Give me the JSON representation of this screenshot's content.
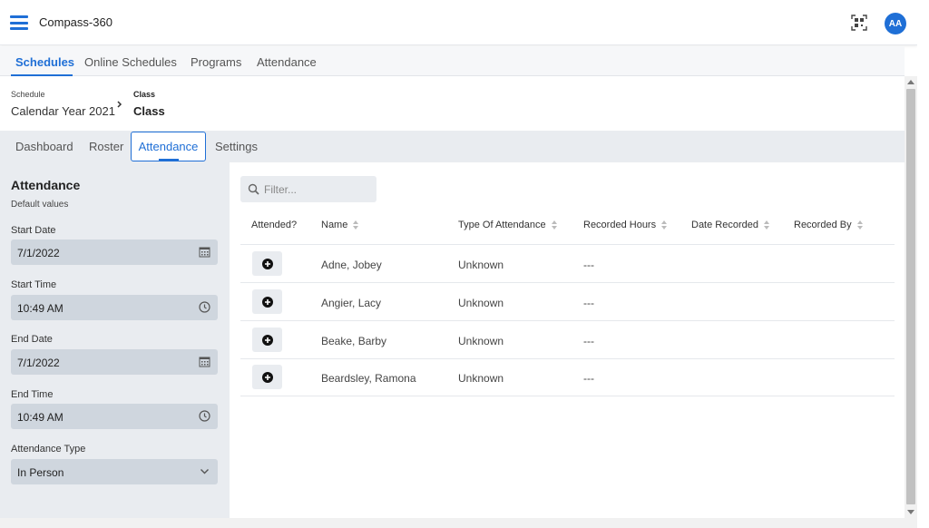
{
  "app": {
    "title": "Compass-360",
    "avatar_initials": "AA"
  },
  "main_nav": {
    "tabs": [
      {
        "label": "Schedules",
        "active": true
      },
      {
        "label": "Online Schedules"
      },
      {
        "label": "Programs"
      },
      {
        "label": "Attendance"
      }
    ]
  },
  "breadcrumb": {
    "schedule_label": "Schedule",
    "schedule_value": "Calendar Year 2021",
    "class_label": "Class",
    "class_value": "Class"
  },
  "sub_tabs": [
    {
      "label": "Dashboard"
    },
    {
      "label": "Roster"
    },
    {
      "label": "Attendance",
      "active": true
    },
    {
      "label": "Settings"
    }
  ],
  "defaults_panel": {
    "title": "Attendance",
    "subtitle": "Default values",
    "start_date": {
      "label": "Start Date",
      "value": "7/1/2022"
    },
    "start_time": {
      "label": "Start Time",
      "value": "10:49 AM"
    },
    "end_date": {
      "label": "End Date",
      "value": "7/1/2022"
    },
    "end_time": {
      "label": "End Time",
      "value": "10:49 AM"
    },
    "attendance_type": {
      "label": "Attendance Type",
      "value": "In Person"
    }
  },
  "filter": {
    "placeholder": "Filter..."
  },
  "table": {
    "columns": [
      "Attended?",
      "Name",
      "Type Of Attendance",
      "Recorded Hours",
      "Date Recorded",
      "Recorded By"
    ],
    "rows": [
      {
        "name": "Adne, Jobey",
        "type": "Unknown",
        "hours": "---",
        "date": "",
        "by": ""
      },
      {
        "name": "Angier, Lacy",
        "type": "Unknown",
        "hours": "---",
        "date": "",
        "by": ""
      },
      {
        "name": "Beake, Barby",
        "type": "Unknown",
        "hours": "---",
        "date": "",
        "by": ""
      },
      {
        "name": "Beardsley, Ramona",
        "type": "Unknown",
        "hours": "---",
        "date": "",
        "by": ""
      }
    ]
  },
  "colors": {
    "accent": "#1f6fd6",
    "panel_bg": "#e9ecf0",
    "field_bg": "#cfd6de"
  }
}
